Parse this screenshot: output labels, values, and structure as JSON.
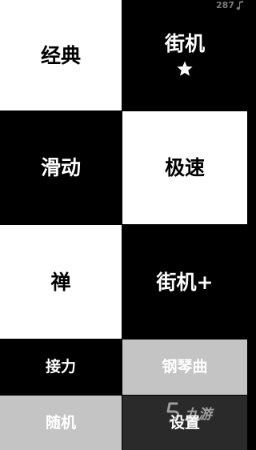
{
  "score": {
    "value": "287",
    "icon": "music-note-icon"
  },
  "tiles": [
    {
      "key": "classic",
      "label": "经典",
      "color": "#ffffff"
    },
    {
      "key": "arcade",
      "label": "街机",
      "color": "#000000",
      "icon": "star-icon"
    },
    {
      "key": "slide",
      "label": "滑动",
      "color": "#000000"
    },
    {
      "key": "speed",
      "label": "极速",
      "color": "#ffffff"
    },
    {
      "key": "zen",
      "label": "禅",
      "color": "#ffffff"
    },
    {
      "key": "arcade_plus",
      "label": "街机+",
      "color": "#000000"
    },
    {
      "key": "relay",
      "label": "接力",
      "color": "#000000"
    },
    {
      "key": "piano_songs",
      "label": "钢琴曲",
      "color": "#c4c4c4"
    },
    {
      "key": "random",
      "label": "随机",
      "color": "#c4c4c4"
    },
    {
      "key": "settings",
      "label": "设置",
      "color": "#2a2a2a"
    }
  ],
  "watermark": {
    "text": "九游",
    "icon": "nine-game-logo-icon"
  }
}
